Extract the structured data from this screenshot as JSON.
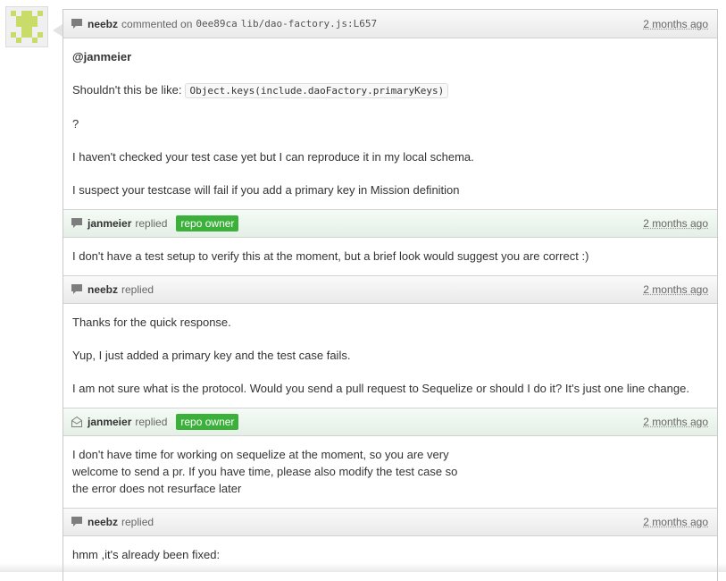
{
  "colors": {
    "badge_bg": "#3bb13b",
    "header_bg": "#eaeaea",
    "owner_header_bg": "#e4efe6",
    "avatar_fg": "#c9dc6a"
  },
  "comment": {
    "icon": "comment-icon",
    "author": "neebz",
    "action": "commented on",
    "commit": "0ee89ca",
    "file": "lib/dao-factory.js:L657",
    "time": "2 months ago",
    "mention": "@janmeier",
    "line1_prefix": "Shouldn't this be like:",
    "line1_code": "Object.keys(include.daoFactory.primaryKeys)",
    "line2": "?",
    "line3": "I haven't checked your test case yet but I can reproduce it in my local schema.",
    "line4": "I suspect your testcase will fail if you add a primary key in Mission definition"
  },
  "replies": [
    {
      "icon": "comment-icon",
      "author": "janmeier",
      "action": "replied",
      "badge": "repo owner",
      "time": "2 months ago",
      "text": "I don't have a test setup to verify this at the moment, but a brief look would suggest you are correct :)"
    },
    {
      "icon": "comment-icon",
      "author": "neebz",
      "action": "replied",
      "time": "2 months ago",
      "p1": "Thanks for the quick response.",
      "p2": "Yup, I just added a primary key and the test case fails.",
      "p3": "I am not sure what is the protocol. Would you send a pull request to Sequelize or should I do it? It's just one line change."
    },
    {
      "icon": "email-icon",
      "author": "janmeier",
      "action": "replied",
      "badge": "repo owner",
      "time": "2 months ago",
      "l1": "I don't have time for working on sequelize at the moment, so you are very",
      "l2": "welcome to send a pr. If you have time, please also modify the test case so",
      "l3": "the error does not resurface later"
    },
    {
      "icon": "comment-icon",
      "author": "neebz",
      "action": "replied",
      "time": "2 months ago",
      "text": "hmm ,it's already been fixed:"
    }
  ]
}
